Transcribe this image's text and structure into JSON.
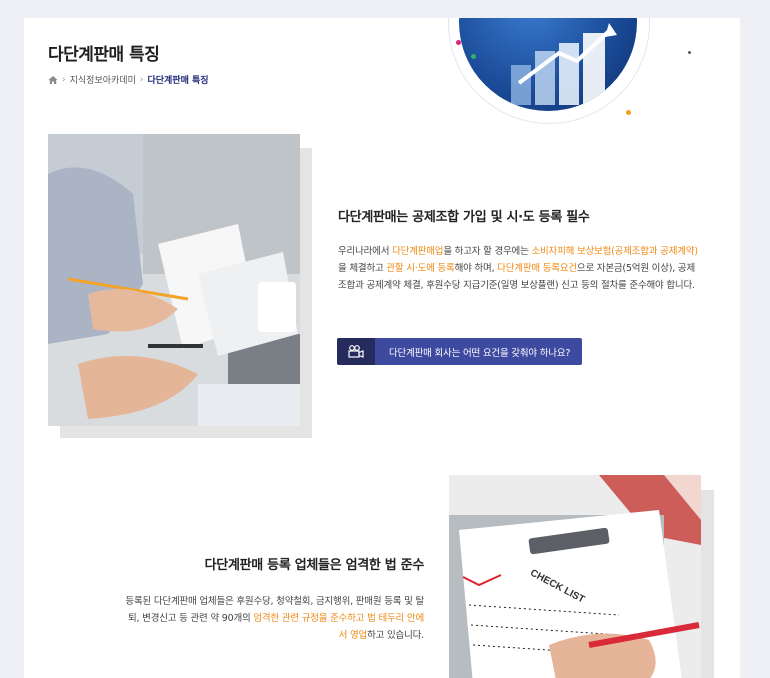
{
  "header": {
    "title": "다단계판매 특징",
    "breadcrumb": {
      "home_icon": "home-icon",
      "items": [
        "지식정보아카데미",
        "다단계판매 특징"
      ]
    }
  },
  "section1": {
    "heading": "다단계판매는 공제조합 가입 및 시·도 등록 필수",
    "body": {
      "t1": "우리나라에서 ",
      "h1": "다단계판매업",
      "t2": "을 하고자 할 경우에는 ",
      "h2": "소비자피해 보상보험(공제조합과 공제계약)",
      "t3": "을 체결하고 ",
      "h3": "관할 시·도에 등록",
      "t4": "해야 하며, ",
      "h4": "다단계판매 등록요건",
      "t5": "으로 자본금(5억원 이상), 공제조합과 공제계약 체결, 후원수당 지급기준(일명 보상플랜) 신고 등의 절차를 준수해야 합니다."
    },
    "cta": {
      "icon": "video-camera-icon",
      "label": "다단계판매 회사는 어떤 요건을 갖춰야 하나요?"
    }
  },
  "section2": {
    "heading": "다단계판매 등록 업체들은 엄격한 법 준수",
    "body": {
      "t1": "등록된 다단계판매 업체들은 후원수당, 청약철회, 금지행위, 판매원 등록 및 탈퇴, 변경신고 등 관련 약 90개의 ",
      "h1": "엄격한 관련 규정을 준수하고 법 테두리 안에서 영업",
      "t2": "하고 있습니다."
    },
    "image_text": "CHECK LIST"
  },
  "colors": {
    "accent_orange": "#f08a13",
    "button_dark": "#252b5c",
    "button_blue": "#3d4aa0",
    "breadcrumb_current": "#1e2a78"
  }
}
